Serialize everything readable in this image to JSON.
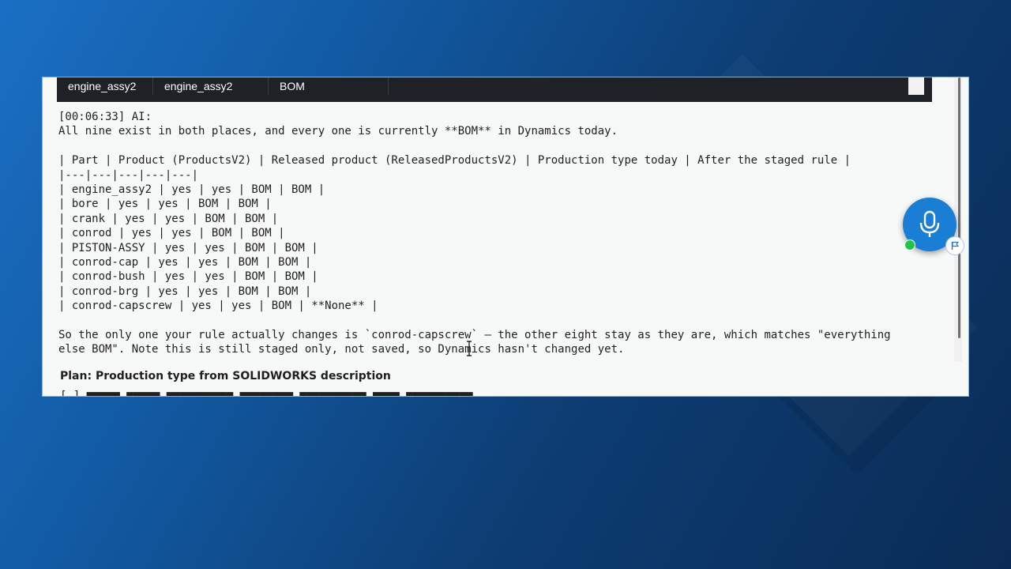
{
  "table_header_row": {
    "cells": [
      "engine_assy2",
      "engine_assy2",
      "BOM"
    ]
  },
  "chat": {
    "lines": [
      "[00:06:33] AI:",
      "All nine exist in both places, and every one is currently **BOM** in Dynamics today.",
      "",
      "| Part | Product (ProductsV2) | Released product (ReleasedProductsV2) | Production type today | After the staged rule |",
      "|---|---|---|---|---|",
      "| engine_assy2 | yes | yes | BOM | BOM |",
      "| bore | yes | yes | BOM | BOM |",
      "| crank | yes | yes | BOM | BOM |",
      "| conrod | yes | yes | BOM | BOM |",
      "| PISTON-ASSY | yes | yes | BOM | BOM |",
      "| conrod-cap | yes | yes | BOM | BOM |",
      "| conrod-bush | yes | yes | BOM | BOM |",
      "| conrod-brg | yes | yes | BOM | BOM |",
      "| conrod-capscrew | yes | yes | BOM | **None** |",
      "",
      "So the only one your rule actually changes is `conrod-capscrew` — the other eight stay as they are, which matches \"everything",
      "else BOM\". Note this is still staged only, not saved, so Dynamics hasn't changed yet."
    ]
  },
  "plan": {
    "title": "Plan: Production type from SOLIDWORKS description"
  },
  "icons": {
    "mic": "microphone-icon",
    "flag": "flag-icon",
    "status": "online-status-dot"
  },
  "colors": {
    "accent": "#1a7fd4",
    "status_online": "#25c24a",
    "row_dark": "#1e2226"
  }
}
